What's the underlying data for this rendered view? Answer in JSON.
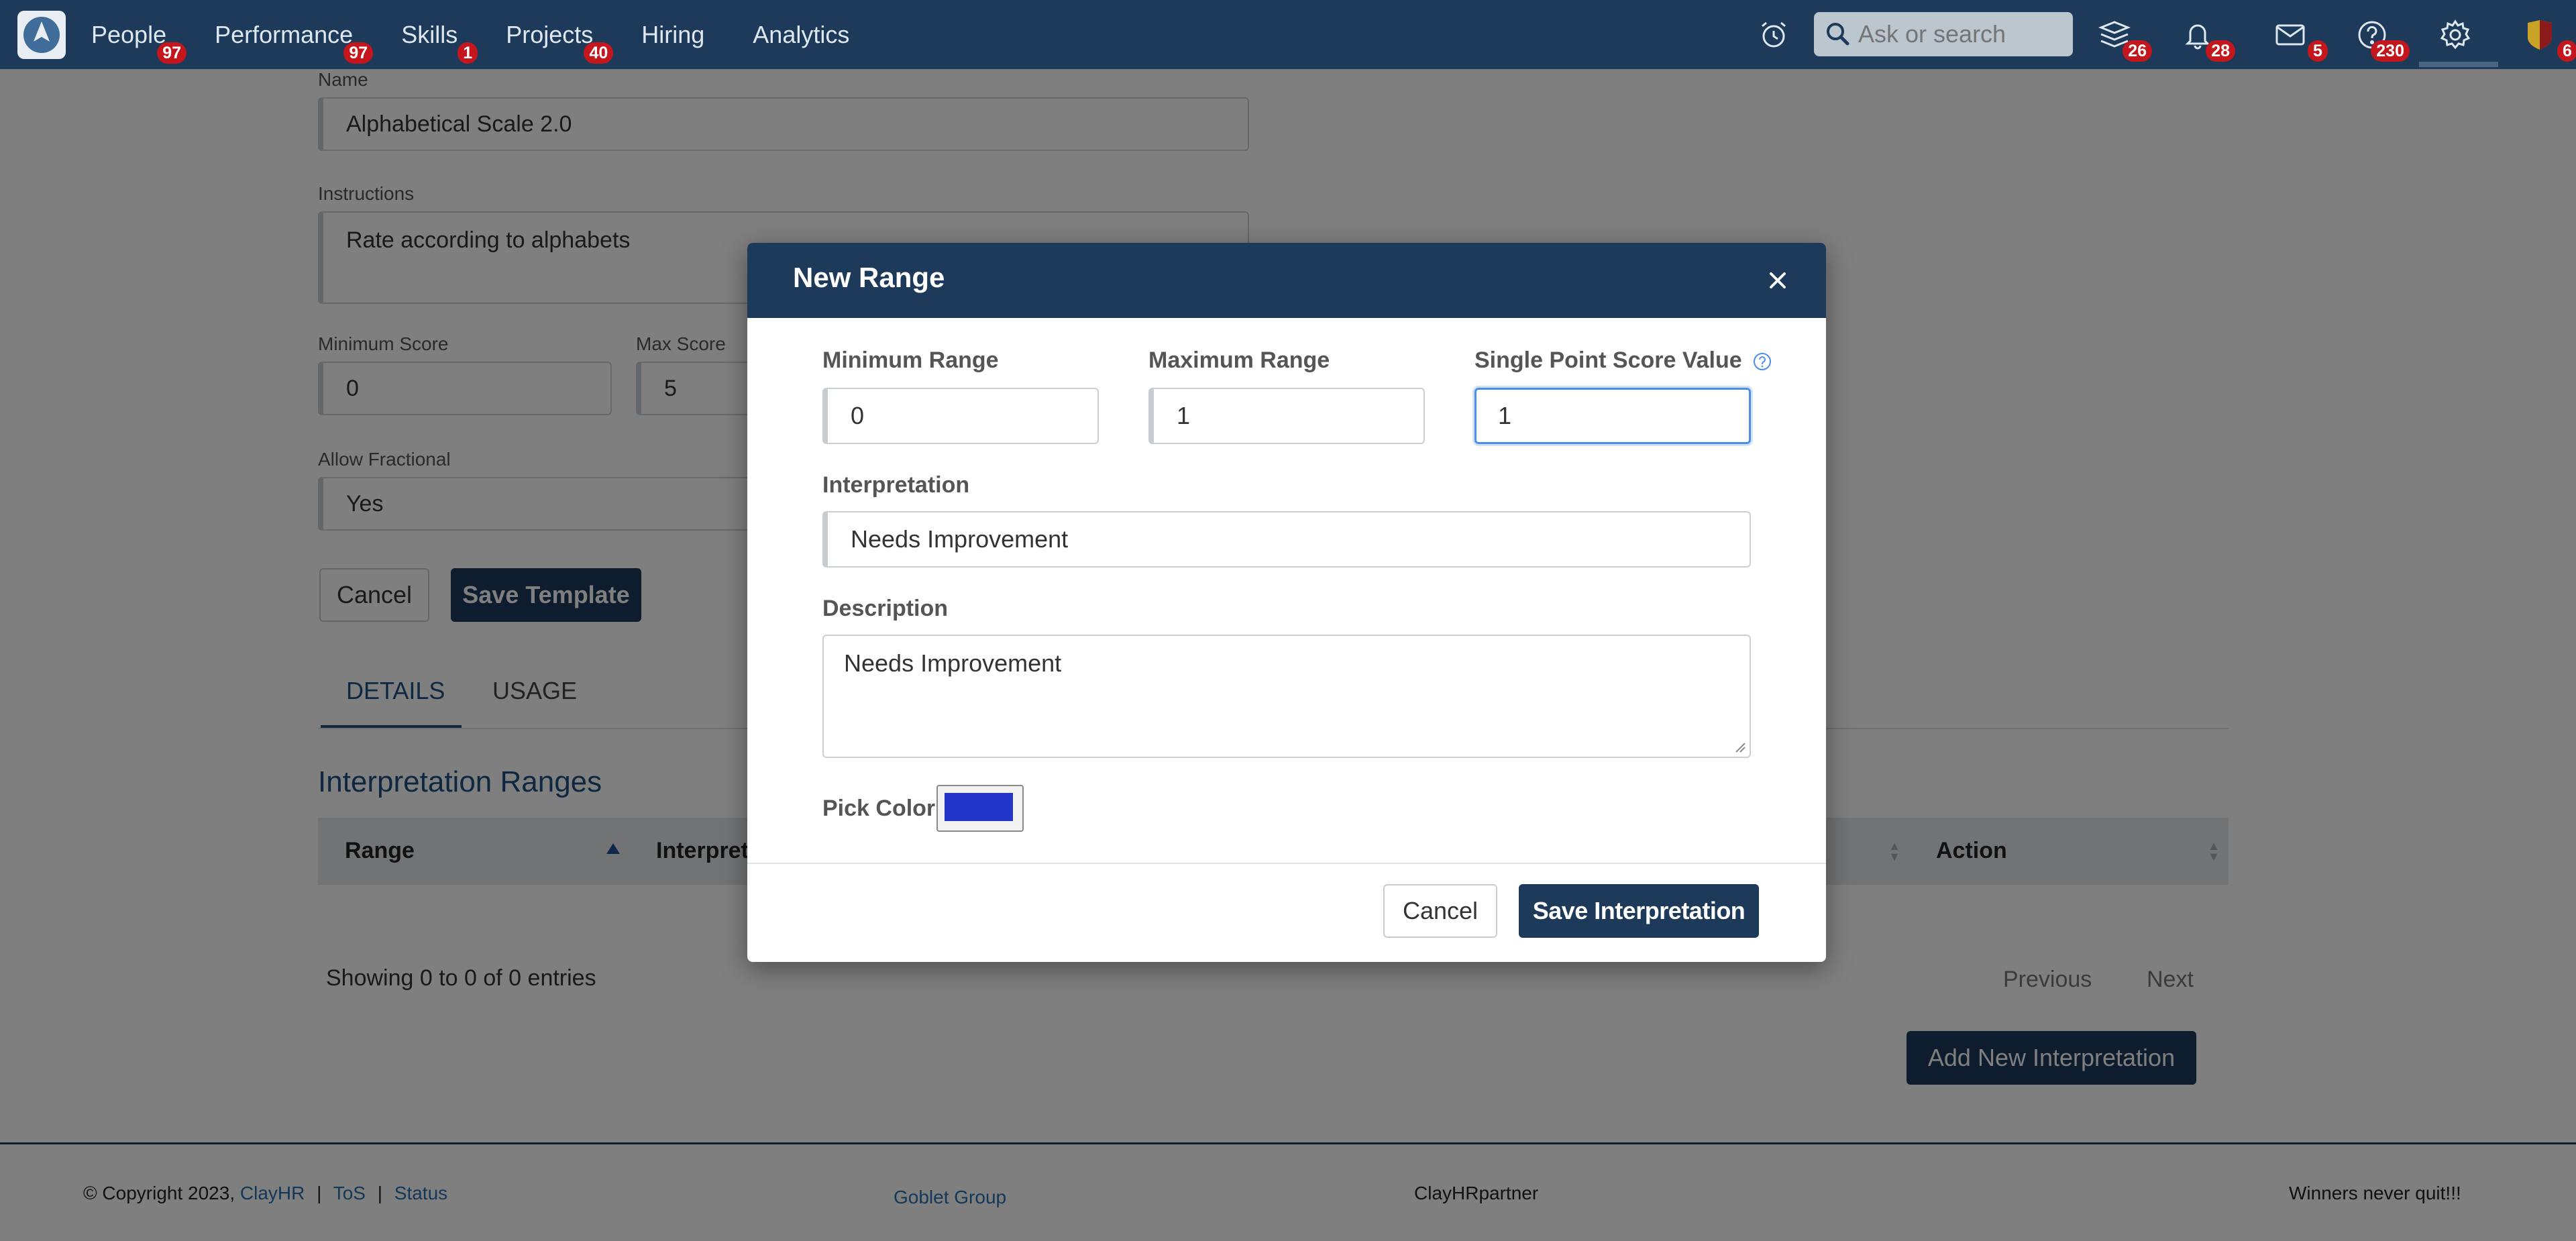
{
  "nav": {
    "items": [
      {
        "label": "People",
        "badge": "97"
      },
      {
        "label": "Performance",
        "badge": "97"
      },
      {
        "label": "Skills",
        "badge": "1"
      },
      {
        "label": "Projects",
        "badge": "40"
      },
      {
        "label": "Hiring",
        "badge": ""
      },
      {
        "label": "Analytics",
        "badge": ""
      }
    ],
    "search_placeholder": "Ask or search",
    "icon_badges": {
      "courses": "26",
      "notifications": "28",
      "messages": "5",
      "help": "230",
      "profile": "6"
    }
  },
  "form": {
    "name_label": "Name",
    "name_value": "Alphabetical Scale 2.0",
    "instructions_label": "Instructions",
    "instructions_value": "Rate according to alphabets",
    "min_score_label": "Minimum Score",
    "min_score_value": "0",
    "max_score_label": "Max Score",
    "max_score_value": "5",
    "allow_fractional_label": "Allow Fractional",
    "allow_fractional_value": "Yes",
    "cancel_label": "Cancel",
    "save_label": "Save Template"
  },
  "tabs": {
    "details": "DETAILS",
    "usage": "USAGE"
  },
  "table": {
    "title": "Interpretation Ranges",
    "col_range": "Range",
    "col_interpretation": "Interpret",
    "col_action": "Action",
    "showing": "Showing 0 to 0 of 0 entries",
    "previous": "Previous",
    "next": "Next",
    "add_button": "Add New Interpretation"
  },
  "footer": {
    "copyright": "© Copyright 2023,",
    "company": "ClayHR",
    "tos": "ToS",
    "status": "Status",
    "separator": "|",
    "center_link": "Goblet Group",
    "partner": "ClayHRpartner",
    "tagline": "Winners never quit!!!"
  },
  "modal": {
    "title": "New Range",
    "min_range_label": "Minimum Range",
    "min_range_value": "0",
    "max_range_label": "Maximum Range",
    "max_range_value": "1",
    "single_point_label": "Single Point Score Value",
    "single_point_value": "1",
    "interpretation_label": "Interpretation",
    "interpretation_value": "Needs Improvement",
    "description_label": "Description",
    "description_value": "Needs Improvement",
    "pick_color_label": "Pick Color",
    "picked_color": "#2336c8",
    "cancel_label": "Cancel",
    "save_label": "Save Interpretation"
  },
  "colors": {
    "brand": "#1d3a5a",
    "badge": "#c3171d",
    "link": "#2a6fb0"
  }
}
